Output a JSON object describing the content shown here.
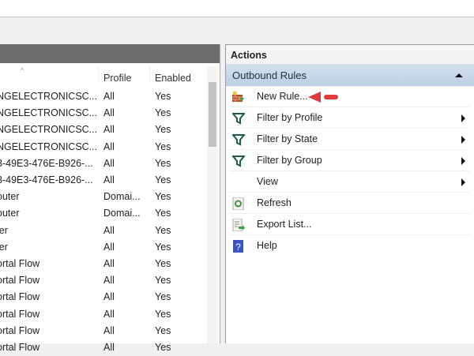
{
  "table": {
    "columns": [
      "Profile",
      "Enabled"
    ],
    "rows": [
      [
        "NGELECTRONICSC...",
        "All",
        "Yes"
      ],
      [
        "NGELECTRONICSC...",
        "All",
        "Yes"
      ],
      [
        "NGELECTRONICSC...",
        "All",
        "Yes"
      ],
      [
        "NGELECTRONICSC...",
        "All",
        "Yes"
      ],
      [
        "3-49E3-476E-B926-...",
        "All",
        "Yes"
      ],
      [
        "3-49E3-476E-B926-...",
        "All",
        "Yes"
      ],
      [
        "outer",
        "Domai...",
        "Yes"
      ],
      [
        "outer",
        "Domai...",
        "Yes"
      ],
      [
        "ler",
        "All",
        "Yes"
      ],
      [
        "ler",
        "All",
        "Yes"
      ],
      [
        "ortal Flow",
        "All",
        "Yes"
      ],
      [
        "ortal Flow",
        "All",
        "Yes"
      ],
      [
        "ortal Flow",
        "All",
        "Yes"
      ],
      [
        "ortal Flow",
        "All",
        "Yes"
      ],
      [
        "ortal Flow",
        "All",
        "Yes"
      ],
      [
        "ortal Flow",
        "All",
        "Yes"
      ]
    ]
  },
  "actions": {
    "title": "Actions",
    "section": "Outbound Rules",
    "items": [
      {
        "label": "New Rule...",
        "icon": "new-rule-icon"
      },
      {
        "label": "Filter by Profile",
        "icon": "filter-icon"
      },
      {
        "label": "Filter by State",
        "icon": "filter-icon"
      },
      {
        "label": "Filter by Group",
        "icon": "filter-icon"
      },
      {
        "label": "View",
        "icon": ""
      },
      {
        "label": "Refresh",
        "icon": "refresh-icon"
      },
      {
        "label": "Export List...",
        "icon": "export-icon"
      },
      {
        "label": "Help",
        "icon": "help-icon"
      }
    ],
    "highlight_color": "#e03c3c"
  }
}
